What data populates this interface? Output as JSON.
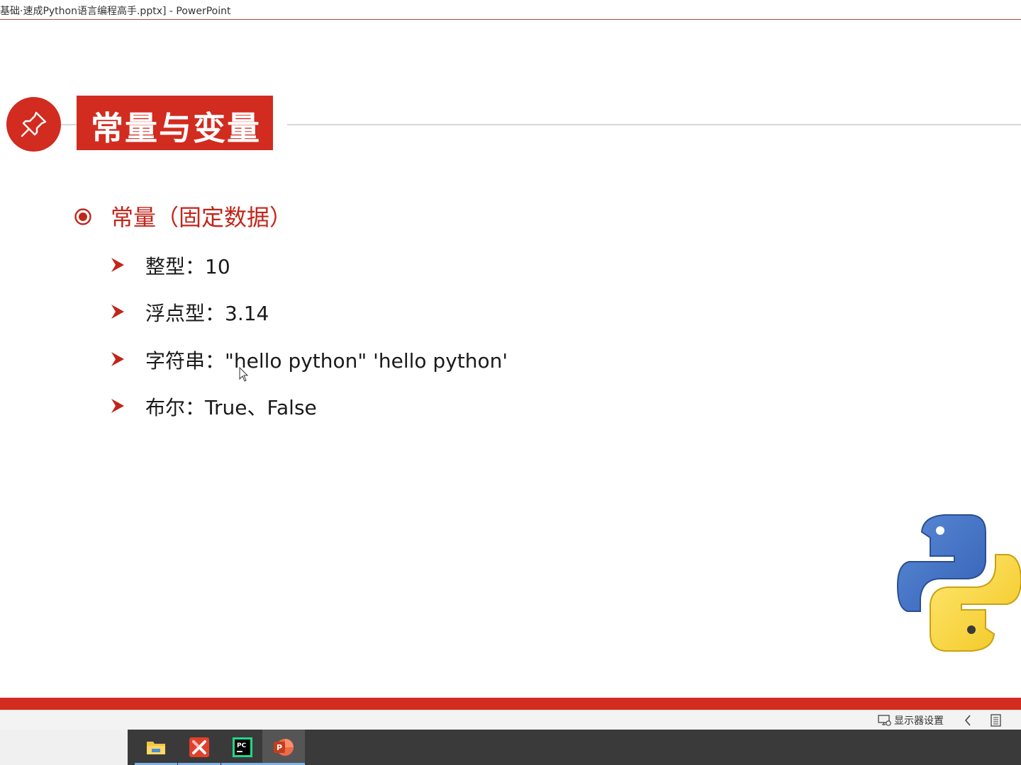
{
  "window": {
    "title": "基础·速成Python语言编程高手.pptx] - PowerPoint"
  },
  "slide": {
    "title": "常量与变量",
    "heading": "常量（固定数据）",
    "items": [
      "整型：10",
      "浮点型：3.14",
      "字符串：\"hello python\" 'hello python'",
      "布尔：True、False"
    ]
  },
  "statusbar": {
    "display_settings": "显示器设置"
  },
  "taskbar": {
    "apps": [
      {
        "icon": "file-explorer-icon"
      },
      {
        "icon": "xmind-icon"
      },
      {
        "icon": "pycharm-icon"
      },
      {
        "icon": "powerpoint-icon"
      }
    ]
  },
  "colors": {
    "accent": "#d22b1f",
    "heading": "#c0261b"
  }
}
